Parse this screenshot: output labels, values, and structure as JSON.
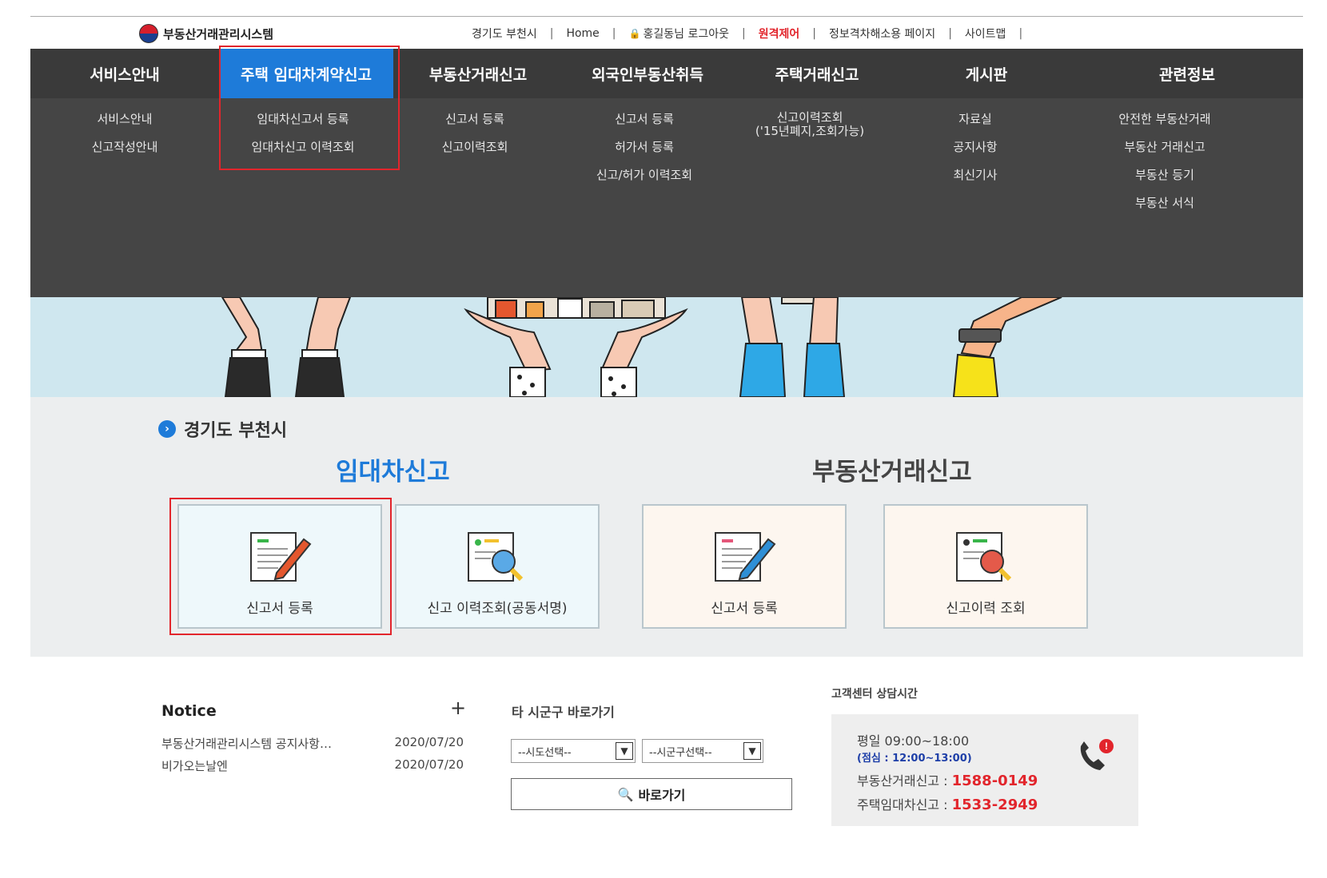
{
  "header": {
    "logo_text": "부동산거래관리시스템",
    "util_links": [
      {
        "label": "경기도 부천시"
      },
      {
        "label": "Home"
      },
      {
        "label": "홍길동님 로그아웃"
      },
      {
        "label": "원격제어"
      },
      {
        "label": "정보격차해소용 페이지"
      },
      {
        "label": "사이트맵"
      }
    ]
  },
  "gnb": {
    "items": [
      {
        "label": "서비스안내"
      },
      {
        "label": "주택 임대차계약신고"
      },
      {
        "label": "부동산거래신고"
      },
      {
        "label": "외국인부동산취득"
      },
      {
        "label": "주택거래신고"
      },
      {
        "label": "게시판"
      },
      {
        "label": "관련정보"
      }
    ],
    "active_index": 1
  },
  "submenu": {
    "col0": [
      "서비스안내",
      "신고작성안내"
    ],
    "col1": [
      "임대차신고서 등록",
      "임대차신고 이력조회"
    ],
    "col2": [
      "신고서 등록",
      "신고이력조회"
    ],
    "col3": [
      "신고서 등록",
      "허가서 등록",
      "신고/허가 이력조회"
    ],
    "col4": [
      "신고이력조회",
      "('15년폐지,조회가능)"
    ],
    "col5": [
      "자료실",
      "공지사항",
      "최신기사"
    ],
    "col6": [
      "안전한 부동산거래",
      "부동산 거래신고",
      "부동산 등기",
      "부동산 서식"
    ]
  },
  "main": {
    "region": "경기도 부천시",
    "lease_title": "임대차신고",
    "trade_title": "부동산거래신고",
    "cards": [
      {
        "label": "신고서 등록"
      },
      {
        "label": "신고 이력조회(공동서명)"
      },
      {
        "label": "신고서 등록"
      },
      {
        "label": "신고이력 조회"
      }
    ]
  },
  "notice": {
    "title": "Notice",
    "plus": "+",
    "rows": [
      {
        "title": "부동산거래관리시스템 공지사항…",
        "date": "2020/07/20"
      },
      {
        "title": "비가오는날엔",
        "date": "2020/07/20"
      }
    ]
  },
  "goto": {
    "title": "타 시군구 바로가기",
    "sido": "--시도선택--",
    "sigungu": "--시군구선택--",
    "button": "바로가기"
  },
  "cs": {
    "title": "고객센터 상담시간",
    "weekday": "평일 09:00~18:00",
    "lunch": "(점심 : 12:00~13:00)",
    "trade_label": "부동산거래신고 : ",
    "trade_num": "1588-0149",
    "lease_label": "주택임대차신고 : ",
    "lease_num": "1533-2949"
  },
  "colors": {
    "accent_blue": "#1e7bd9",
    "highlight_red": "#e2252c",
    "gnb_bg": "#3a3a3a"
  }
}
